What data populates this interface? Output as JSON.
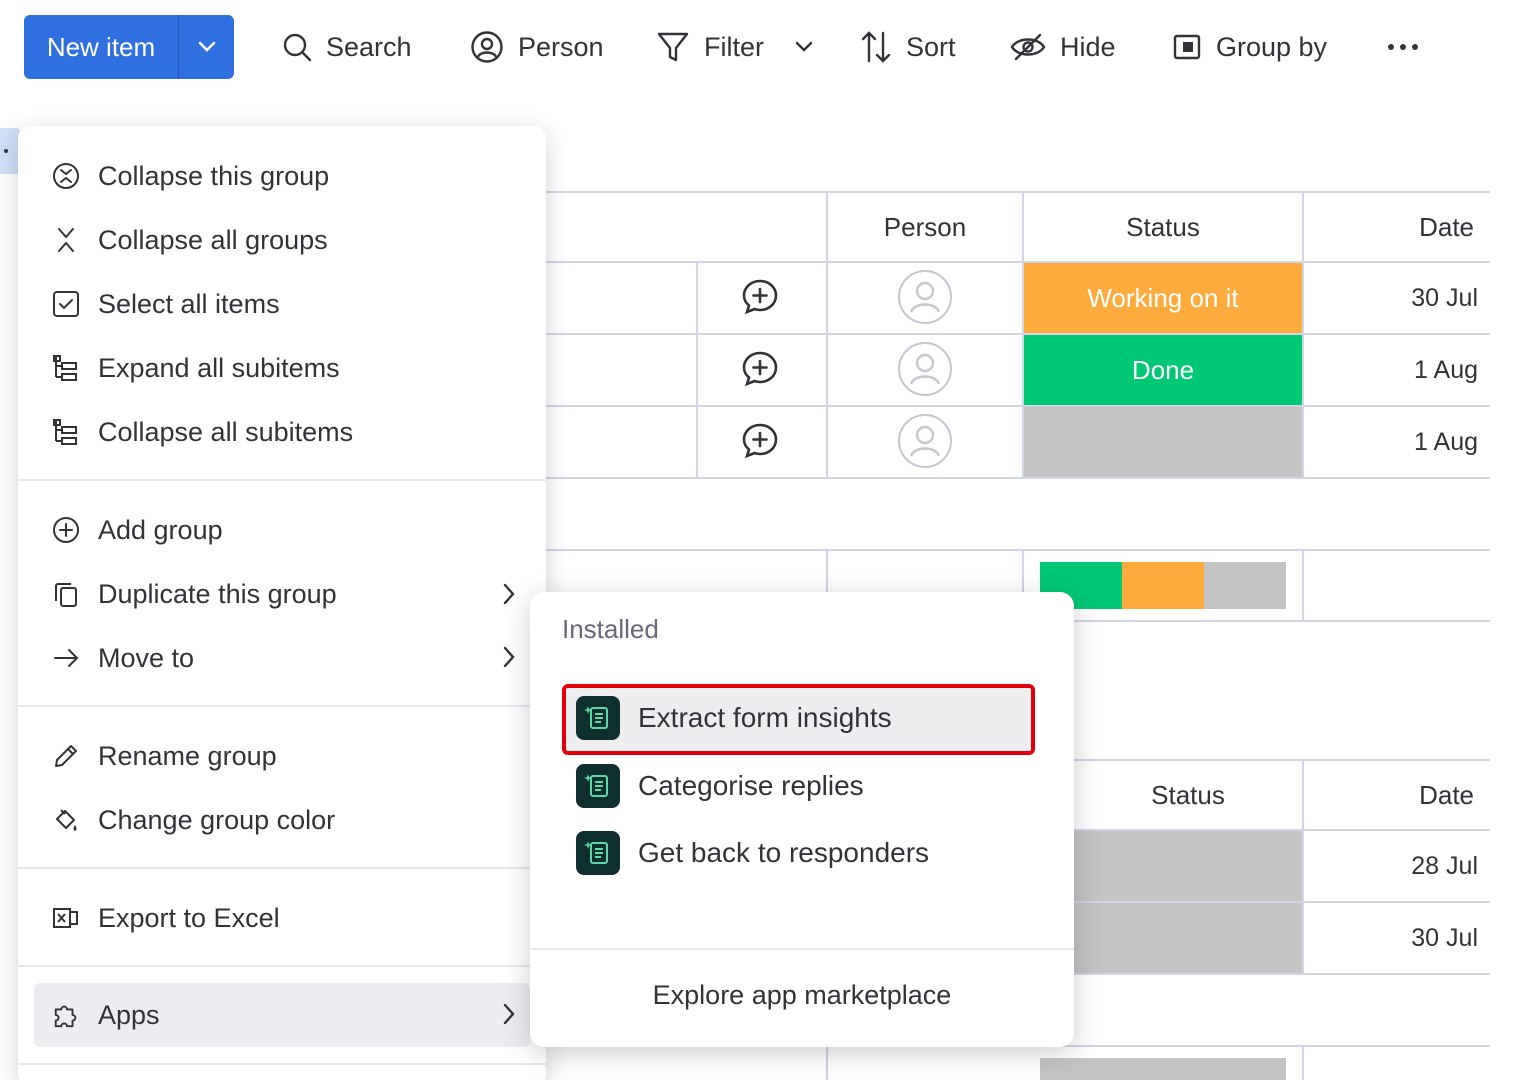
{
  "toolbar": {
    "new_item": "New item",
    "search": "Search",
    "person": "Person",
    "filter": "Filter",
    "sort": "Sort",
    "hide": "Hide",
    "group_by": "Group by"
  },
  "board": {
    "group1": {
      "headers": {
        "person": "Person",
        "status": "Status",
        "date": "Date"
      },
      "rows": [
        {
          "status": "Working on it",
          "status_color": "#fdab3d",
          "date": "30 Jul"
        },
        {
          "status": "Done",
          "status_color": "#00c875",
          "date": "1 Aug"
        },
        {
          "status": "",
          "status_color": "#c4c4c4",
          "date": "1 Aug"
        }
      ],
      "summary_colors": [
        "#00c875",
        "#fdab3d",
        "#c4c4c4"
      ]
    },
    "group2": {
      "headers": {
        "status": "Status",
        "date": "Date"
      },
      "rows": [
        {
          "date": "28 Jul"
        },
        {
          "date": "30 Jul"
        }
      ]
    }
  },
  "menu": {
    "collapse_group": "Collapse this group",
    "collapse_all": "Collapse all groups",
    "select_all": "Select all items",
    "expand_subitems": "Expand all subitems",
    "collapse_subitems": "Collapse all subitems",
    "add_group": "Add group",
    "duplicate_group": "Duplicate this group",
    "move_to": "Move to",
    "rename_group": "Rename group",
    "change_color": "Change group color",
    "export_excel": "Export to Excel",
    "apps": "Apps"
  },
  "submenu": {
    "section": "Installed",
    "apps": [
      "Extract form insights",
      "Categorise replies",
      "Get back to responders"
    ],
    "explore": "Explore app marketplace"
  }
}
